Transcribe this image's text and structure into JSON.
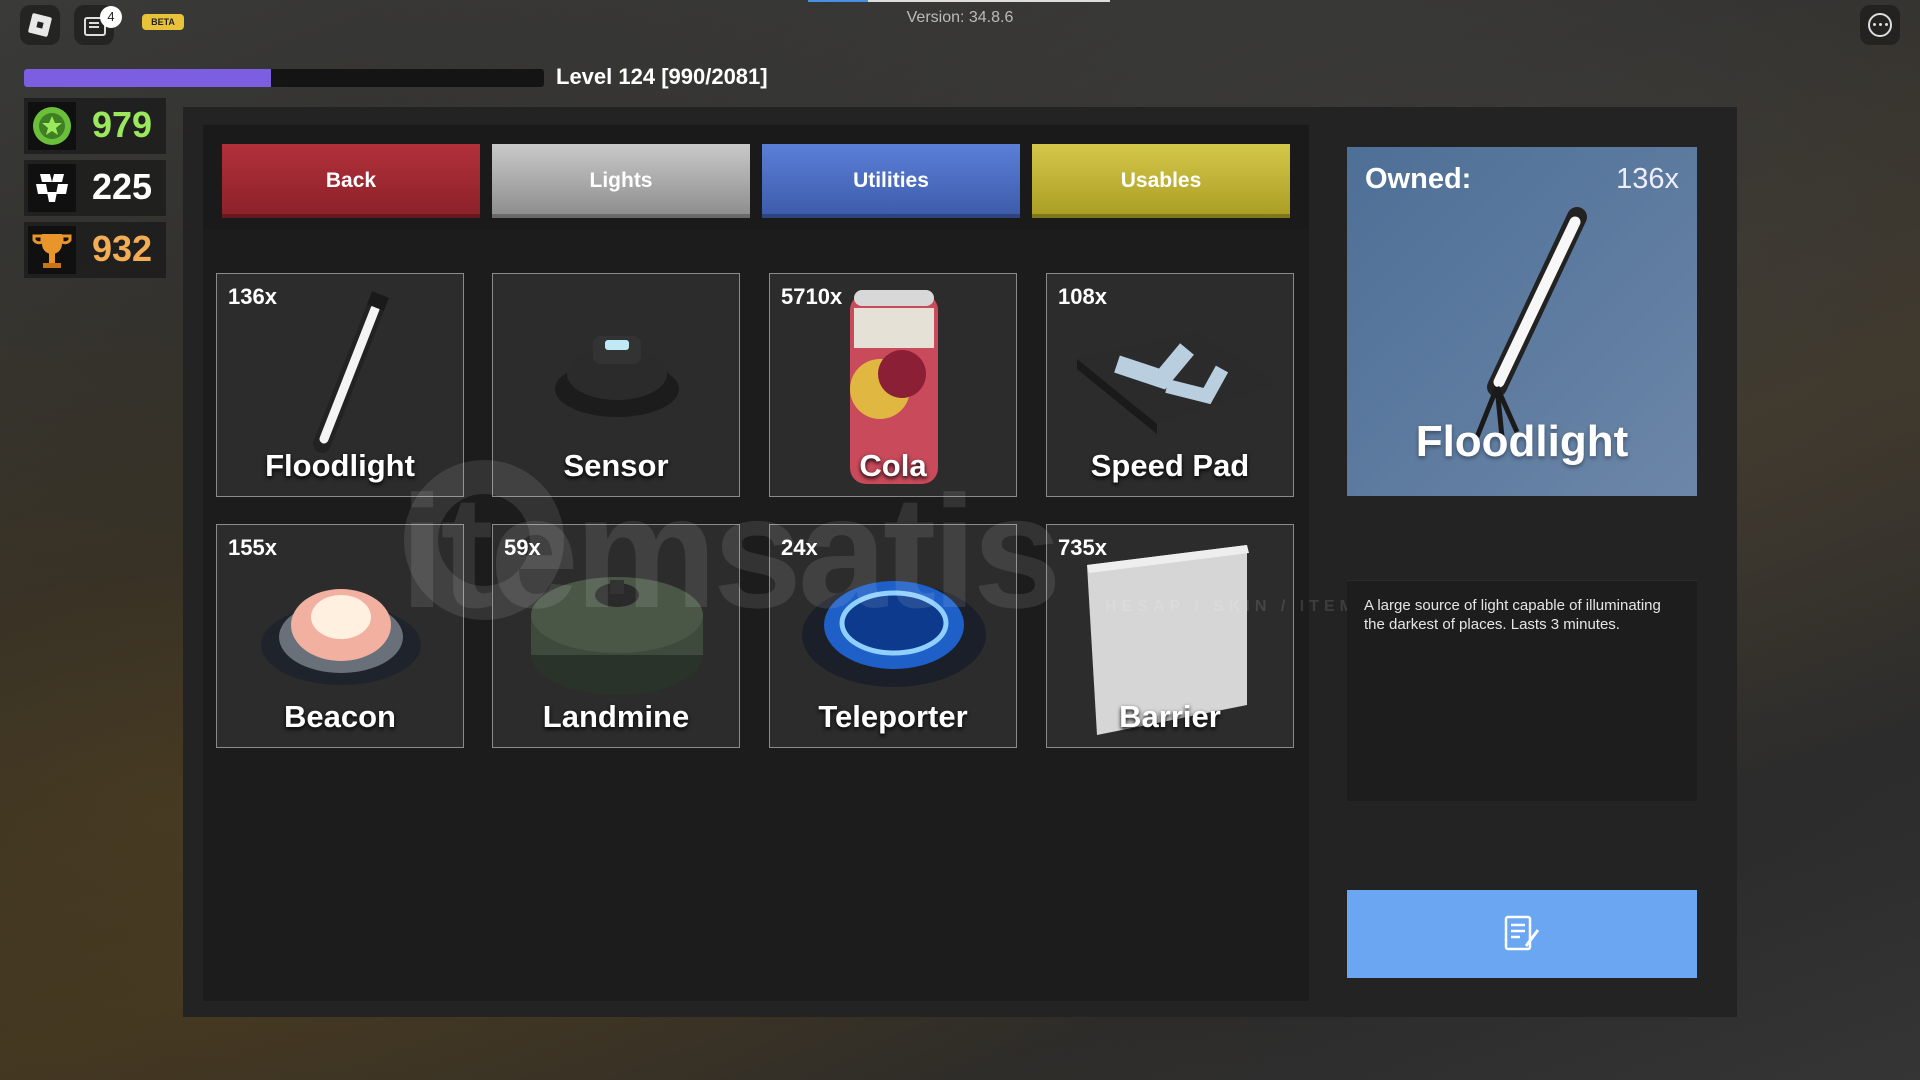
{
  "top": {
    "version": "Version: 34.8.6",
    "notification_count": "4",
    "beta_label": "BETA"
  },
  "level": {
    "text": "Level 124 [990/2081]",
    "current_xp": 990,
    "required_xp": 2081
  },
  "stats": [
    {
      "value": "979",
      "icon": "star-coin-icon",
      "color": "#9be85c"
    },
    {
      "value": "225",
      "icon": "cubes-icon",
      "color": "#ffffff"
    },
    {
      "value": "932",
      "icon": "trophy-icon",
      "color": "#f2ad55"
    }
  ],
  "tabs": [
    {
      "label": "Back",
      "color": "#b2303a"
    },
    {
      "label": "Lights",
      "color": "#c9c9c9"
    },
    {
      "label": "Utilities",
      "color": "#5b7fd8"
    },
    {
      "label": "Usables",
      "color": "#d4c84a"
    }
  ],
  "items": [
    {
      "count": "136x",
      "name": "Floodlight",
      "icon": "floodlight-icon"
    },
    {
      "count": "",
      "name": "Sensor",
      "icon": "sensor-icon"
    },
    {
      "count": "5710x",
      "name": "Cola",
      "icon": "cola-can-icon"
    },
    {
      "count": "108x",
      "name": "Speed Pad",
      "icon": "speed-pad-icon"
    },
    {
      "count": "155x",
      "name": "Beacon",
      "icon": "beacon-icon"
    },
    {
      "count": "59x",
      "name": "Landmine",
      "icon": "landmine-icon"
    },
    {
      "count": "24x",
      "name": "Teleporter",
      "icon": "teleporter-icon"
    },
    {
      "count": "735x",
      "name": "Barrier",
      "icon": "barrier-icon"
    }
  ],
  "preview": {
    "owned_label": "Owned:",
    "owned_value": "136x",
    "name": "Floodlight",
    "description": "A large source of light capable of illuminating the darkest of places. Lasts 3 minutes."
  },
  "watermark": {
    "text": "itemsatis",
    "subtext": "HESAP / SKIN / ITEM / E"
  }
}
